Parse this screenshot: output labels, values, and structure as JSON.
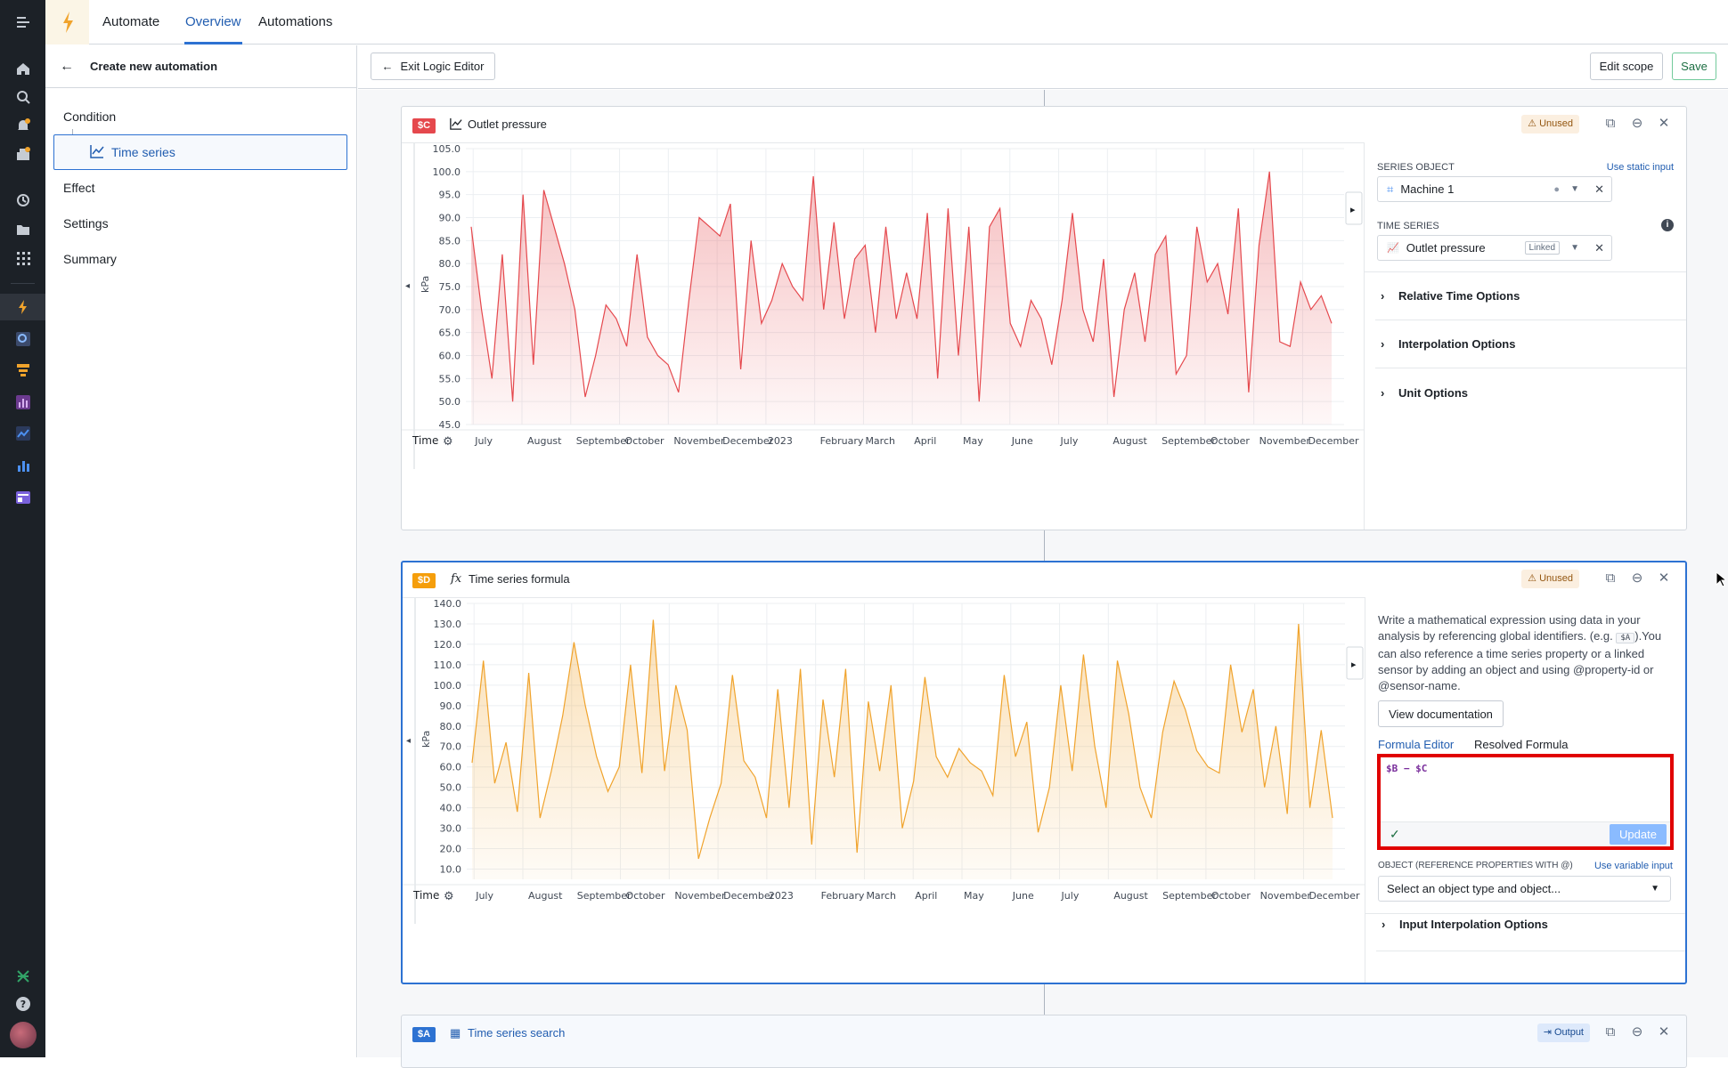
{
  "topnav": {
    "app": "Automate",
    "tabs": [
      "Overview",
      "Automations"
    ]
  },
  "left_panel": {
    "title": "Create new automation",
    "sections": [
      "Condition",
      "Effect",
      "Settings",
      "Summary"
    ],
    "condition_child": "Time series"
  },
  "toolbar": {
    "exit": "Exit Logic Editor",
    "edit_scope": "Edit scope",
    "save": "Save"
  },
  "card_c": {
    "tag": "$C",
    "tag_color": "#e5484d",
    "title": "Outlet pressure",
    "status": "Unused",
    "chart_data": {
      "type": "area",
      "ylabel": "kPa",
      "color": "#e5484d",
      "yticks": [
        "105.0",
        "100.0",
        "95.0",
        "90.0",
        "85.0",
        "80.0",
        "75.0",
        "70.0",
        "65.0",
        "60.0",
        "55.0",
        "50.0",
        "45.0"
      ],
      "ylim": [
        45,
        105
      ],
      "xticks": [
        "July",
        "August",
        "September",
        "October",
        "November",
        "December",
        "2023",
        "February",
        "March",
        "April",
        "May",
        "June",
        "July",
        "August",
        "September",
        "October",
        "November",
        "December"
      ],
      "values": [
        88,
        70,
        55,
        82,
        50,
        95,
        58,
        96,
        88,
        80,
        70,
        51,
        60,
        71,
        68,
        62,
        82,
        64,
        60,
        58,
        52,
        72,
        90,
        88,
        86,
        93,
        57,
        85,
        67,
        72,
        80,
        75,
        72,
        99,
        70,
        89,
        68,
        81,
        84,
        65,
        88,
        68,
        78,
        68,
        91,
        55,
        92,
        60,
        88,
        50,
        88,
        92,
        67,
        62,
        72,
        68,
        58,
        72,
        91,
        70,
        63,
        81,
        51,
        70,
        78,
        63,
        82,
        86,
        56,
        60,
        88,
        76,
        80,
        69,
        92,
        52,
        84,
        100,
        63,
        62,
        76,
        70,
        73,
        67
      ],
      "xlabel": "Time"
    }
  },
  "side_c": {
    "series_object_label": "SERIES OBJECT",
    "static_link": "Use static input",
    "object": "Machine 1",
    "time_series_label": "TIME SERIES",
    "time_series": "Outlet pressure",
    "linked": "Linked",
    "accordions": [
      "Relative Time Options",
      "Interpolation Options",
      "Unit Options"
    ]
  },
  "card_d": {
    "tag": "$D",
    "tag_color": "#f59e0b",
    "title": "Time series formula",
    "status": "Unused",
    "chart_data": {
      "type": "area",
      "ylabel": "kPa",
      "color": "#f0a32c",
      "yticks": [
        "140.0",
        "130.0",
        "120.0",
        "110.0",
        "100.0",
        "90.0",
        "80.0",
        "70.0",
        "60.0",
        "50.0",
        "40.0",
        "30.0",
        "20.0",
        "10.0"
      ],
      "ylim": [
        5,
        140
      ],
      "xticks": [
        "July",
        "August",
        "September",
        "October",
        "November",
        "December",
        "2023",
        "February",
        "March",
        "April",
        "May",
        "June",
        "July",
        "August",
        "September",
        "October",
        "November",
        "December"
      ],
      "values": [
        62,
        112,
        52,
        72,
        38,
        106,
        35,
        58,
        85,
        121,
        90,
        65,
        48,
        60,
        110,
        57,
        132,
        58,
        100,
        78,
        15,
        35,
        52,
        105,
        63,
        55,
        35,
        98,
        40,
        108,
        22,
        93,
        55,
        108,
        18,
        92,
        58,
        100,
        30,
        53,
        104,
        65,
        55,
        69,
        62,
        58,
        46,
        105,
        65,
        82,
        28,
        50,
        100,
        58,
        115,
        70,
        40,
        112,
        86,
        50,
        35,
        77,
        102,
        88,
        68,
        60,
        57,
        110,
        77,
        98,
        50,
        80,
        37,
        130,
        40,
        78,
        35
      ],
      "xlabel": "Time"
    }
  },
  "side_d": {
    "description_1": "Write a mathematical expression using data in your analysis by referencing global identifiers. (e.g.",
    "example_code": "$A",
    "description_2": ").You can also reference a time series property or a linked sensor by adding an object and using @property-id or @sensor-name.",
    "doc_button": "View documentation",
    "tab_editor": "Formula Editor",
    "tab_resolved": "Resolved Formula",
    "formula": "$B − $C",
    "update": "Update",
    "object_label": "OBJECT (REFERENCE PROPERTIES WITH @)",
    "variable_link": "Use variable input",
    "object_placeholder": "Select an object type and object...",
    "cut_accordion": "Input Interpolation Options"
  },
  "card_a": {
    "tag": "$A",
    "tag_color": "#2d72d2",
    "title": "Time series search",
    "status": "Output"
  }
}
